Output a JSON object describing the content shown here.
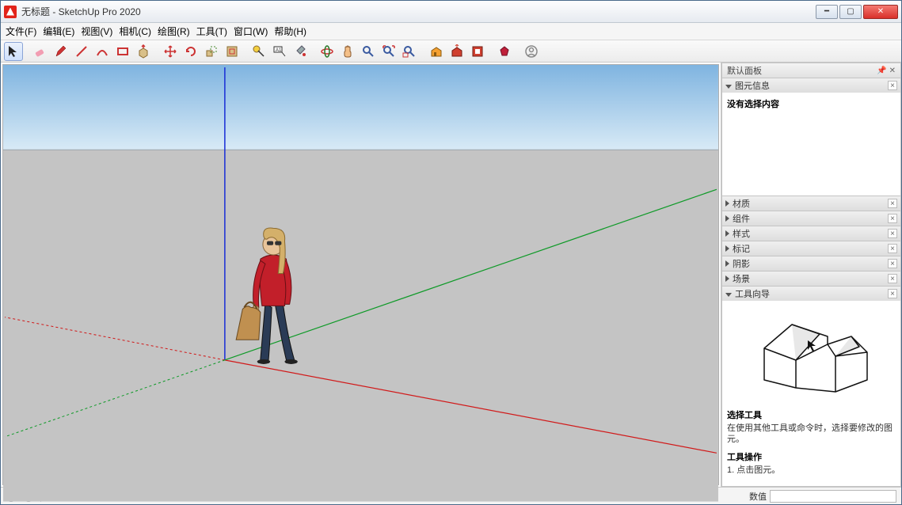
{
  "titlebar": {
    "title": "无标题 - SketchUp Pro 2020"
  },
  "menu": {
    "file": "文件(F)",
    "edit": "编辑(E)",
    "view": "视图(V)",
    "camera": "相机(C)",
    "draw": "绘图(R)",
    "tools": "工具(T)",
    "window": "窗口(W)",
    "help": "帮助(H)"
  },
  "toolbar_icons": [
    "select-arrow",
    "eraser",
    "pencil",
    "line",
    "arc",
    "rectangle",
    "push-pull",
    "move",
    "rotate",
    "scale",
    "offset",
    "tape-measure",
    "text-label",
    "paint-bucket",
    "orbit",
    "pan",
    "zoom",
    "zoom-extents",
    "zoom-window",
    "position-camera",
    "look-around",
    "section-plane",
    "walk",
    "add-location",
    "3d-warehouse",
    "extension-warehouse",
    "ruby-console",
    "user-account"
  ],
  "right_panel": {
    "tray_title": "默认面板",
    "sections": {
      "entity_info": {
        "label": "图元信息",
        "body": "没有选择内容"
      },
      "materials": {
        "label": "材质"
      },
      "components": {
        "label": "组件"
      },
      "styles": {
        "label": "样式"
      },
      "tags": {
        "label": "标记"
      },
      "shadows": {
        "label": "阴影"
      },
      "scenes": {
        "label": "场景"
      },
      "instructor": {
        "label": "工具向导",
        "title": "选择工具",
        "desc": "在使用其他工具或命令时，选择要修改的图元。",
        "op_title": "工具操作",
        "op_step1": "1. 点击图元。"
      }
    }
  },
  "statusbar": {
    "hint": "选择对象。切换到扩充选择。拖动鼠标选择多项。",
    "measure_label": "数值"
  }
}
